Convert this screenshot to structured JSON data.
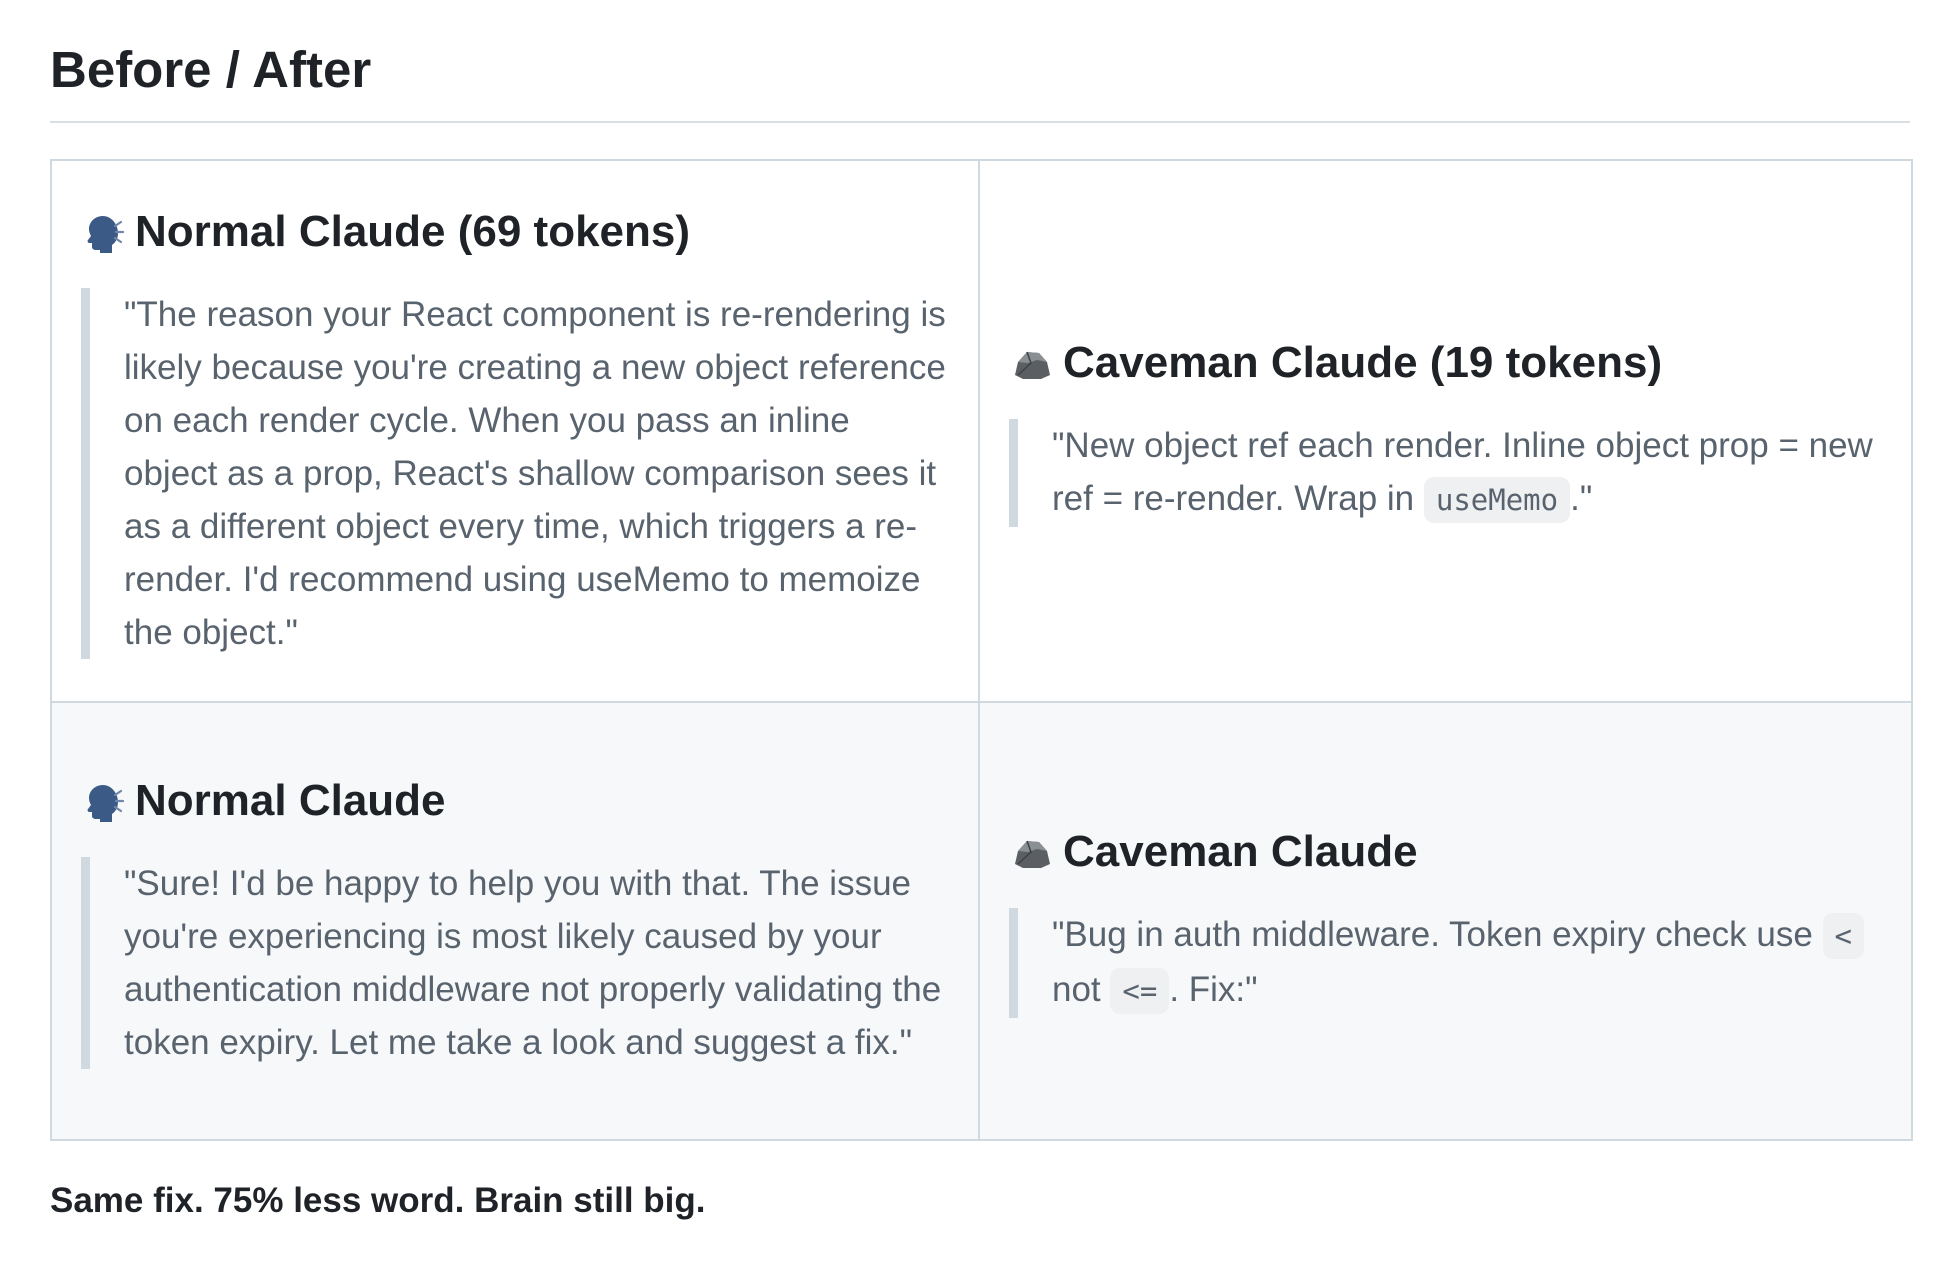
{
  "heading": "Before / After",
  "rows": [
    {
      "normal": {
        "title": "Normal Claude (69 tokens)",
        "icon": "speaking-head-icon",
        "quote": "\"The reason your React component is re-rendering is likely because you're creating a new object reference on each render cycle. When you pass an inline object as a prop, React's shallow comparison sees it as a different object every time, which triggers a re-render. I'd recommend using useMemo to memoize the object.\""
      },
      "caveman": {
        "title": "Caveman Claude (19 tokens)",
        "icon": "rock-icon",
        "quote_part1": "\"New object ref each render. Inline object prop = new ref = re-render. Wrap in ",
        "code1": "useMemo",
        "quote_part2": ".\""
      }
    },
    {
      "normal": {
        "title": "Normal Claude",
        "icon": "speaking-head-icon",
        "quote": "\"Sure! I'd be happy to help you with that. The issue you're experiencing is most likely caused by your authentication middleware not properly validating the token expiry. Let me take a look and suggest a fix.\""
      },
      "caveman": {
        "title": "Caveman Claude",
        "icon": "rock-icon",
        "quote_part1": "\"Bug in auth middleware. Token expiry check use ",
        "code1": "<",
        "quote_mid": " not ",
        "code2": "<=",
        "quote_part2": ". Fix:\""
      }
    }
  ],
  "summary": "Same fix. 75% less word. Brain still big."
}
